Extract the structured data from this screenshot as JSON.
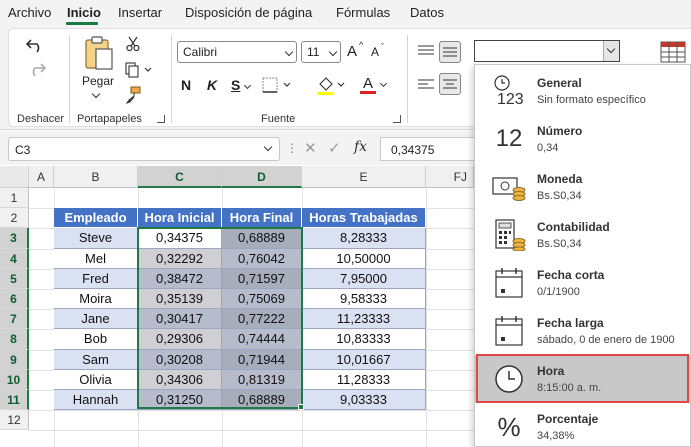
{
  "menu": {
    "items": [
      "Archivo",
      "Inicio",
      "Insertar",
      "Disposición de página",
      "Fórmulas",
      "Datos"
    ],
    "active": "Inicio"
  },
  "ribbon": {
    "undo_group_label": "Deshacer",
    "clipboard_group_label": "Portapapeles",
    "paste_label": "Pegar",
    "font_group_label": "Fuente",
    "font_name": "Calibri",
    "font_size": "11",
    "bold_letter": "N",
    "italic_letter": "K",
    "underline_letter": "S",
    "font_color_letter": "A",
    "grow_font_letter": "A",
    "shrink_font_letter": "A",
    "number_format_value": ""
  },
  "formula_bar": {
    "name_box": "C3",
    "formula": "0,34375",
    "fx_label": "fx"
  },
  "grid": {
    "columns": [
      "A",
      "B",
      "C",
      "D",
      "E",
      "FJ"
    ],
    "rows": [
      "1",
      "2",
      "3",
      "4",
      "5",
      "6",
      "7",
      "8",
      "9",
      "10",
      "11",
      "12"
    ],
    "table_headers": [
      "Empleado",
      "Hora Inicial",
      "Hora Final",
      "Horas Trabajadas"
    ],
    "table_rows": [
      [
        "Steve",
        "0,34375",
        "0,68889",
        "8,28333"
      ],
      [
        "Mel",
        "0,32292",
        "0,76042",
        "10,50000"
      ],
      [
        "Fred",
        "0,38472",
        "0,71597",
        "7,95000"
      ],
      [
        "Moira",
        "0,35139",
        "0,75069",
        "9,58333"
      ],
      [
        "Jane",
        "0,30417",
        "0,77222",
        "11,23333"
      ],
      [
        "Bob",
        "0,29306",
        "0,74444",
        "10,83333"
      ],
      [
        "Sam",
        "0,30208",
        "0,71944",
        "10,01667"
      ],
      [
        "Olivia",
        "0,34306",
        "0,81319",
        "11,28333"
      ],
      [
        "Hannah",
        "0,31250",
        "0,68889",
        "9,03333"
      ]
    ]
  },
  "number_format_menu": {
    "items": [
      {
        "title": "General",
        "sample": "Sin formato específico",
        "icon": "general-123-icon"
      },
      {
        "title": "Número",
        "sample": "0,34",
        "icon": "number-12-icon"
      },
      {
        "title": "Moneda",
        "sample": "Bs.S0,34",
        "icon": "currency-icon"
      },
      {
        "title": "Contabilidad",
        "sample": " Bs.S0,34",
        "icon": "accounting-icon"
      },
      {
        "title": "Fecha corta",
        "sample": "0/1/1900",
        "icon": "calendar-short-icon"
      },
      {
        "title": "Fecha larga",
        "sample": "sábado, 0 de enero de 1900",
        "icon": "calendar-long-icon"
      },
      {
        "title": "Hora",
        "sample": "8:15:00 a. m.",
        "icon": "clock-icon"
      },
      {
        "title": "Porcentaje",
        "sample": "34,38%",
        "icon": "percent-icon"
      }
    ],
    "highlighted": "Hora",
    "icon_glyphs": {
      "general": "123",
      "number": "12",
      "percent": "%"
    }
  },
  "colors": {
    "accent_green": "#1f7a43",
    "table_header_blue": "#4472c4",
    "band_blue": "#d9e1f2",
    "highlight_red": "#e04848"
  }
}
